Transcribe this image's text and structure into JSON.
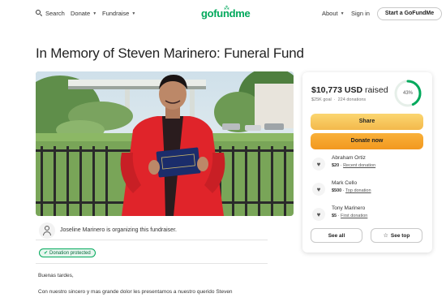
{
  "nav": {
    "search_label": "Search",
    "donate_label": "Donate",
    "fundraise_label": "Fundraise",
    "logo_text": "gofundme",
    "about_label": "About",
    "signin_label": "Sign in",
    "start_label": "Start a GoFundMe",
    "icons": [
      "search-icon",
      "chevron-down-icon"
    ]
  },
  "campaign": {
    "title": "In Memory of Steven Marinero: Funeral Fund",
    "hero_image": "graduate-in-red-gown",
    "diploma_text": "Board of Education"
  },
  "organizer": {
    "text": "Joseline Marinero is organizing this fundraiser."
  },
  "badge": {
    "label": "Donation protected"
  },
  "story": {
    "greeting": "Buenas tardes,",
    "line1": "Con nuestro sincero y mas grande dolor les presentamos a nuestro querido Steven"
  },
  "card": {
    "raised": "$10,773 USD",
    "raised_label": "raised",
    "goal": "$25K goal",
    "donations": "224 donations",
    "progress_pct": 43,
    "progress_label": "43%",
    "share_label": "Share",
    "donate_label": "Donate now",
    "donations_list": [
      {
        "name": "Abraham Ortiz",
        "amount": "$20",
        "tag": "Recent donation"
      },
      {
        "name": "Mark Cello",
        "amount": "$500",
        "tag": "Top donation"
      },
      {
        "name": "Tony Marinero",
        "amount": "$5",
        "tag": "First donation"
      }
    ],
    "see_all_label": "See all",
    "see_top_label": "See top"
  },
  "colors": {
    "brand_green": "#02a95c",
    "share_yellow": "#fbd671",
    "donate_orange": "#f2981f"
  }
}
